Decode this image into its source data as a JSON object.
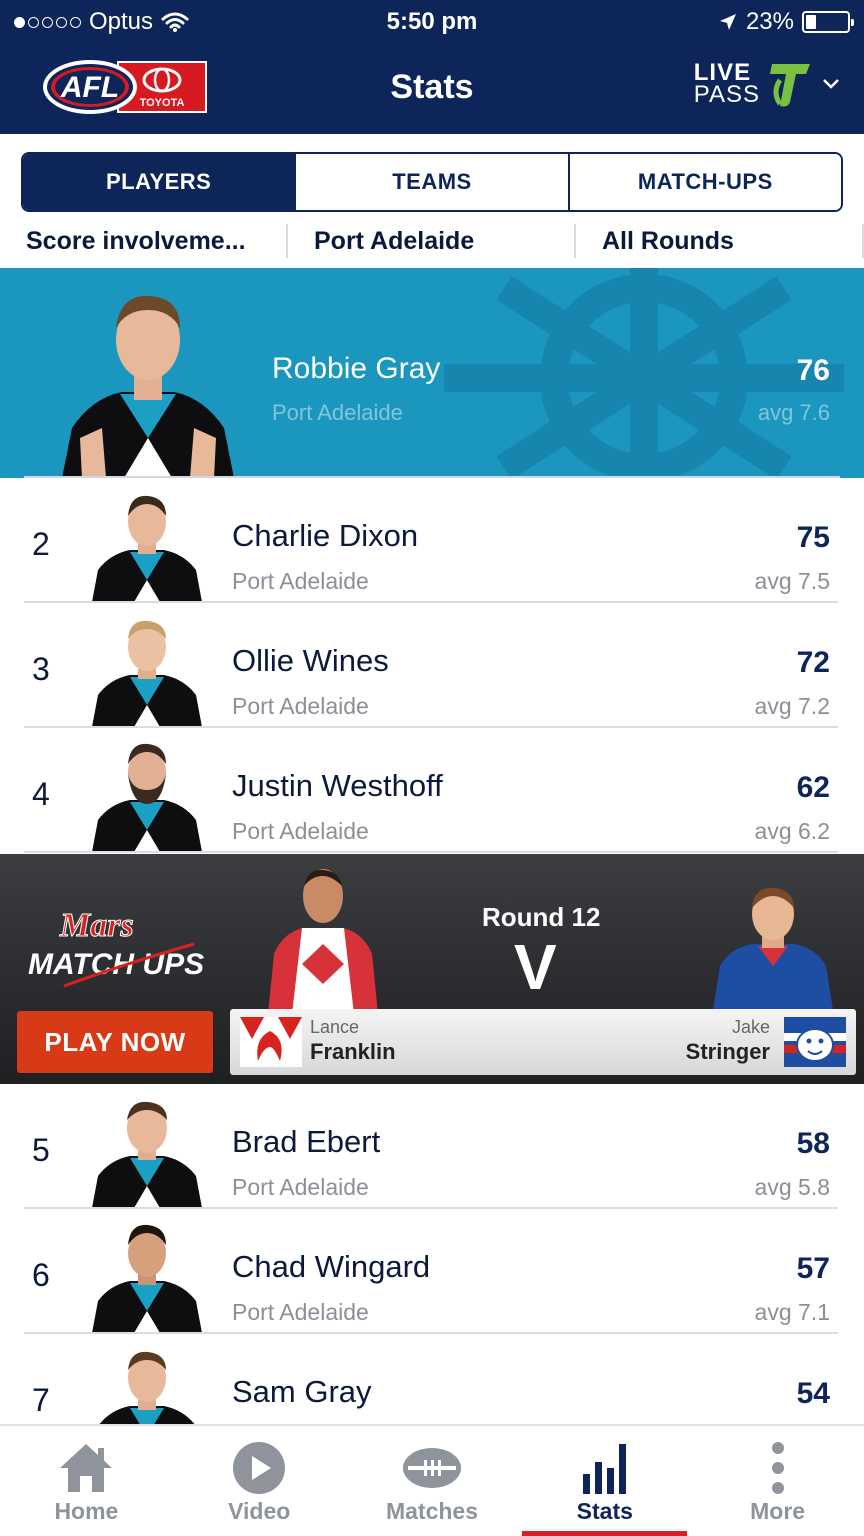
{
  "status_bar": {
    "carrier": "Optus",
    "time": "5:50 pm",
    "battery": "23%"
  },
  "header": {
    "title": "Stats",
    "afl_logo_text": "AFL",
    "sponsor_text": "TOYOTA",
    "livepass_line1": "LIVE",
    "livepass_line2": "PASS"
  },
  "tabs": [
    {
      "label": "PLAYERS",
      "active": true
    },
    {
      "label": "TEAMS",
      "active": false
    },
    {
      "label": "MATCH-UPS",
      "active": false
    }
  ],
  "filters": {
    "stat": "Score involveme...",
    "team": "Port Adelaide",
    "rounds": "All Rounds"
  },
  "top_player": {
    "name": "Robbie Gray",
    "team": "Port Adelaide",
    "value": "76",
    "avg": "avg 7.6"
  },
  "players": [
    {
      "rank": "2",
      "name": "Charlie Dixon",
      "team": "Port Adelaide",
      "value": "75",
      "avg": "avg 7.5"
    },
    {
      "rank": "3",
      "name": "Ollie Wines",
      "team": "Port Adelaide",
      "value": "72",
      "avg": "avg 7.2"
    },
    {
      "rank": "4",
      "name": "Justin Westhoff",
      "team": "Port Adelaide",
      "value": "62",
      "avg": "avg 6.2"
    },
    {
      "rank": "5",
      "name": "Brad Ebert",
      "team": "Port Adelaide",
      "value": "58",
      "avg": "avg 5.8"
    },
    {
      "rank": "6",
      "name": "Chad Wingard",
      "team": "Port Adelaide",
      "value": "57",
      "avg": "avg 7.1"
    },
    {
      "rank": "7",
      "name": "Sam Gray",
      "team": "",
      "value": "54",
      "avg": ""
    }
  ],
  "ad": {
    "brand_line1": "Mars",
    "brand_line2": "MATCH UPS",
    "round": "Round 12",
    "vs": "V",
    "cta": "PLAY NOW",
    "player1_first": "Lance",
    "player1_last": "Franklin",
    "player2_first": "Jake",
    "player2_last": "Stringer"
  },
  "bottom_nav": [
    {
      "label": "Home",
      "icon": "home-icon",
      "active": false
    },
    {
      "label": "Video",
      "icon": "play-icon",
      "active": false
    },
    {
      "label": "Matches",
      "icon": "football-icon",
      "active": false
    },
    {
      "label": "Stats",
      "icon": "bar-chart-icon",
      "active": true
    },
    {
      "label": "More",
      "icon": "more-vertical-icon",
      "active": false
    }
  ],
  "colors": {
    "navy": "#0d2559",
    "banner_blue": "#1b96bf",
    "accent_red": "#e21b2a",
    "cta_red": "#d83a18",
    "livepass_green": "#7ac143"
  }
}
